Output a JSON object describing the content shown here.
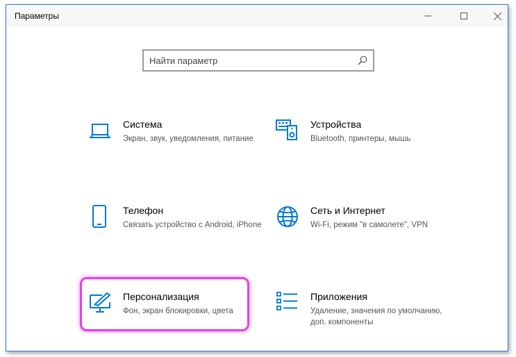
{
  "window": {
    "title": "Параметры",
    "accent_color": "#0078d7"
  },
  "search": {
    "placeholder": "Найти параметр",
    "icon": "search-icon"
  },
  "tiles": [
    {
      "name": "Система",
      "desc": "Экран, звук, уведомления, питание",
      "icon": "laptop-icon"
    },
    {
      "name": "Устройства",
      "desc": "Bluetooth, принтеры, мышь",
      "icon": "devices-icon"
    },
    {
      "name": "Телефон",
      "desc": "Связать устройство с Android, iPhone",
      "icon": "phone-icon"
    },
    {
      "name": "Сеть и Интернет",
      "desc": "Wi-Fi, режим \"в самолете\", VPN",
      "icon": "globe-icon"
    },
    {
      "name": "Персонализация",
      "desc": "Фон, экран блокировки, цвета",
      "icon": "personalization-icon",
      "highlighted": true
    },
    {
      "name": "Приложения",
      "desc": "Удаление, значения по умолчанию, доп. компоненты",
      "icon": "apps-list-icon"
    }
  ]
}
